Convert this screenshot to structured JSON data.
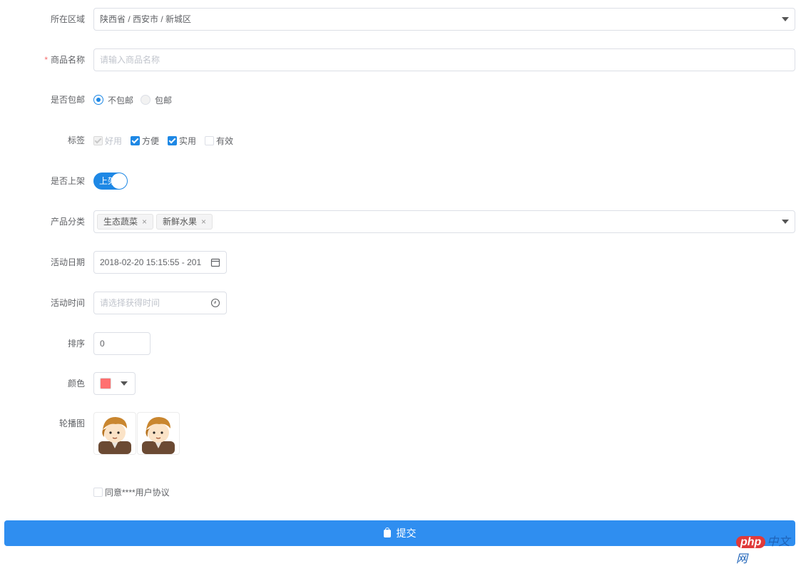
{
  "form": {
    "region": {
      "label": "所在区域",
      "value": "陕西省 / 西安市 / 新城区"
    },
    "product_name": {
      "label": "商品名称",
      "required_mark": "*",
      "placeholder": "请输入商品名称"
    },
    "shipping": {
      "label": "是否包邮",
      "options": [
        "不包邮",
        "包邮"
      ],
      "selected": "不包邮"
    },
    "tags": {
      "label": "标签",
      "options": [
        {
          "text": "好用",
          "checked": true,
          "disabled": true
        },
        {
          "text": "方便",
          "checked": true,
          "disabled": false
        },
        {
          "text": "实用",
          "checked": true,
          "disabled": false
        },
        {
          "text": "有效",
          "checked": false,
          "disabled": false
        }
      ]
    },
    "on_shelf": {
      "label": "是否上架",
      "switch_text": "上架",
      "on": true
    },
    "category": {
      "label": "产品分类",
      "chips": [
        "生态蔬菜",
        "新鲜水果"
      ],
      "remove_glyph": "×"
    },
    "activity_date": {
      "label": "活动日期",
      "value": "2018-02-20 15:15:55 - 201"
    },
    "activity_time": {
      "label": "活动时间",
      "placeholder": "请选择获得时间"
    },
    "sort": {
      "label": "排序",
      "value": "0"
    },
    "color": {
      "label": "颜色",
      "value": "#ff7070"
    },
    "carousel": {
      "label": "轮播图",
      "image_count": 2
    },
    "agreement": {
      "text": "同意****用户协议",
      "checked": false
    },
    "submit": {
      "label": "提交"
    }
  },
  "watermark": {
    "php": "php",
    "cn": "中文网"
  },
  "colors": {
    "accent": "#2f8ef0",
    "required": "#f56c6c"
  }
}
